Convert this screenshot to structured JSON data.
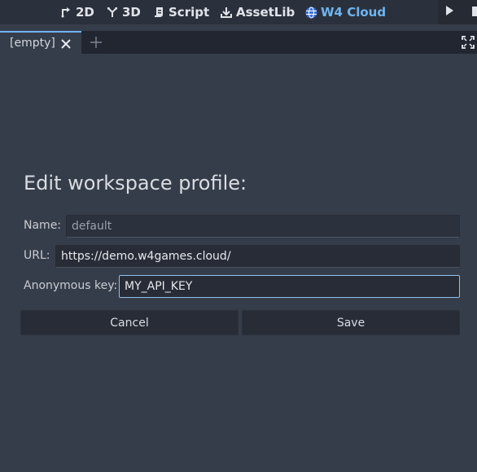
{
  "workspaces": {
    "items": [
      {
        "label": "2D",
        "icon": "2d-icon"
      },
      {
        "label": "3D",
        "icon": "3d-icon"
      },
      {
        "label": "Script",
        "icon": "script-icon"
      },
      {
        "label": "AssetLib",
        "icon": "download-icon"
      },
      {
        "label": "W4 Cloud",
        "icon": "globe-icon",
        "active": true
      }
    ]
  },
  "tabs": {
    "items": [
      {
        "label": "[empty]",
        "active": true
      }
    ]
  },
  "form": {
    "title": "Edit workspace profile:",
    "name_label": "Name:",
    "name_value": "default",
    "url_label": "URL:",
    "url_value": "https://demo.w4games.cloud/",
    "key_label": "Anonymous key:",
    "key_value": "MY_API_KEY",
    "cancel_label": "Cancel",
    "save_label": "Save"
  },
  "colors": {
    "background": "#363d4a",
    "accent": "#6fb5f0",
    "field_bg": "#272c36"
  }
}
